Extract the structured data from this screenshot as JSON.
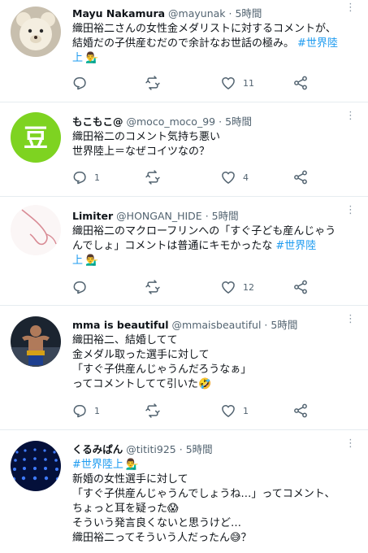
{
  "tweets": [
    {
      "name": "Mayu Nakamura",
      "handle": "@mayunak",
      "time": "5時間",
      "lines": [
        "織田裕二さんの女性金メダリストに対するコメントが、",
        "結婚だの子供産むだので余計なお世話の極み。"
      ],
      "hashtag_inline": "#世界陸",
      "hashtag_next": "上",
      "emoji_after": "💁‍♂️",
      "reply_count": "",
      "retweet_count": "",
      "like_count": "11"
    },
    {
      "name": "もこもこ@",
      "handle": "@moco_moco_99",
      "time": "5時間",
      "lines": [
        "織田裕二のコメント気持ち悪い",
        "世界陸上＝なぜコイツなの？"
      ],
      "reply_count": "1",
      "retweet_count": "",
      "like_count": "4",
      "avatar_glyph": "豆"
    },
    {
      "name": "Limiter",
      "handle": "@HONGAN_HIDE",
      "time": "5時間",
      "lines": [
        "織田裕二のマクローフリンへの「すぐ子ども産んじゃう",
        "んでしょ」コメントは普通にキモかったな"
      ],
      "hashtag_inline": "#世界陸",
      "hashtag_next": "上",
      "emoji_after": "💁‍♂️",
      "reply_count": "",
      "retweet_count": "",
      "like_count": "12"
    },
    {
      "name": "mma is beautiful",
      "handle": "@mmaisbeautiful",
      "time": "5時間",
      "lines": [
        "織田裕二、結婚してて",
        "金メダル取った選手に対して",
        "「すぐ子供産んじゃうんだろうなぁ」",
        "ってコメントしてて引いた🤣"
      ],
      "reply_count": "1",
      "retweet_count": "",
      "like_count": "1"
    },
    {
      "name": "くるみぱん",
      "handle": "@tititi925",
      "time": "5時間",
      "hashtag_line": "#世界陸上",
      "emoji_after": "💁‍♂️",
      "lines": [
        "新婚の女性選手に対して",
        "「すぐ子供産んじゃうんでしょうね…」ってコメント、",
        "ちょっと耳を疑った😱",
        "そういう発言良くないと思うけど…",
        "織田裕二ってそういう人だったん😅？"
      ]
    }
  ],
  "colors": {
    "hashtag": "#1d9bf0",
    "secondary": "#536471",
    "divider": "#e6ecf0",
    "avatar2_bg": "#7ed321"
  },
  "icons": {
    "reply": "reply-icon",
    "retweet": "retweet-icon",
    "like": "heart-icon",
    "share": "share-icon",
    "more": "more-icon"
  }
}
